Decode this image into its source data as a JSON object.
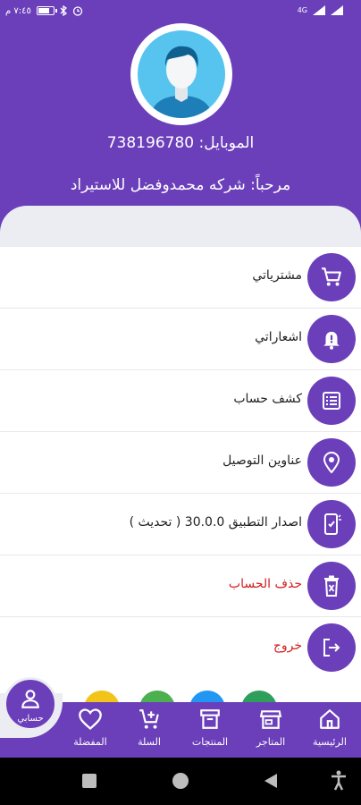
{
  "status_bar": {
    "time": "٧:٤٥ م",
    "network": "4G"
  },
  "profile": {
    "mobile": "الموبايل: 738196780",
    "welcome": "مرحباً: شركه محمدوفضل للاستيراد"
  },
  "menu": {
    "items": [
      {
        "label": "مشترياتي",
        "icon": "cart-icon"
      },
      {
        "label": "اشعاراتي",
        "icon": "bell-icon"
      },
      {
        "label": "كشف حساب",
        "icon": "statement-list-icon"
      },
      {
        "label": "عناوين التوصيل",
        "icon": "location-pin-icon"
      },
      {
        "label": "اصدار التطبيق 30.0.0 ( تحديث )",
        "icon": "phone-update-icon"
      },
      {
        "label": "حذف الحساب",
        "icon": "trash-icon"
      },
      {
        "label": "خروج",
        "icon": "logout-icon"
      }
    ]
  },
  "bottom_nav": {
    "account": "حسابي",
    "favorites": "المفضلة",
    "cart": "السلة",
    "products": "المنتجات",
    "stores": "المتاجر",
    "home": "الرئيسية"
  },
  "colors": {
    "primary": "#6b3fba",
    "danger": "#d02020",
    "surface": "#ebedf3"
  }
}
